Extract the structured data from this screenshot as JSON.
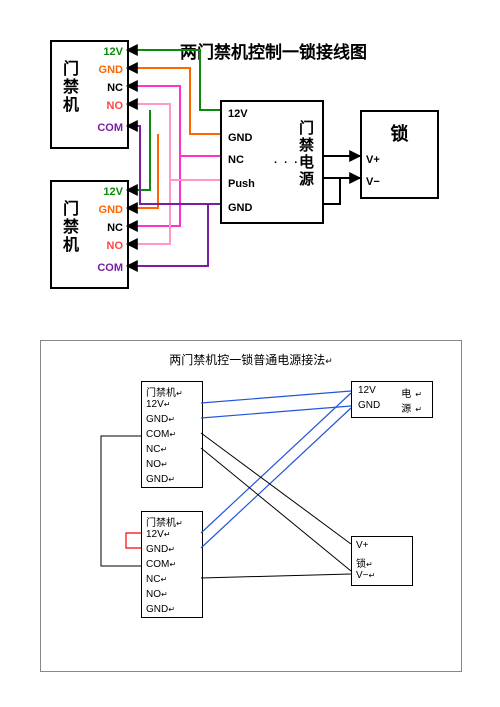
{
  "diagram1": {
    "title": "两门禁机控制一锁接线图",
    "device1": {
      "name": "门禁机",
      "pins": [
        "12V",
        "GND",
        "NC",
        "NO",
        "COM"
      ]
    },
    "device2": {
      "name": "门禁机",
      "pins": [
        "12V",
        "GND",
        "NC",
        "NO",
        "COM"
      ]
    },
    "psu": {
      "name": "门禁电源",
      "pins": [
        "12V",
        "GND",
        "NC",
        "Push",
        "GND"
      ],
      "dots": ". . ."
    },
    "lock": {
      "name": "锁",
      "pins": [
        "V+",
        "V−"
      ]
    },
    "colors": {
      "12v": "#0a8a0a",
      "gnd": "#ff6600",
      "nc": "#ff33cc",
      "no": "#ff99cc",
      "com": "#7a1fa2",
      "lock": "#000"
    }
  },
  "diagram2": {
    "title": "两门禁机控一锁普通电源接法",
    "suffix": "↵",
    "device1": {
      "name": "门禁机",
      "pins": [
        "12V",
        "GND",
        "COM",
        "NC",
        "NO",
        "GND"
      ]
    },
    "device2": {
      "name": "门禁机",
      "pins": [
        "12V",
        "GND",
        "COM",
        "NC",
        "NO",
        "GND"
      ]
    },
    "psu": {
      "name": "电源",
      "pins": [
        "12V",
        "GND"
      ]
    },
    "lock": {
      "name": "锁",
      "pins": [
        "V+",
        "V−"
      ]
    }
  }
}
